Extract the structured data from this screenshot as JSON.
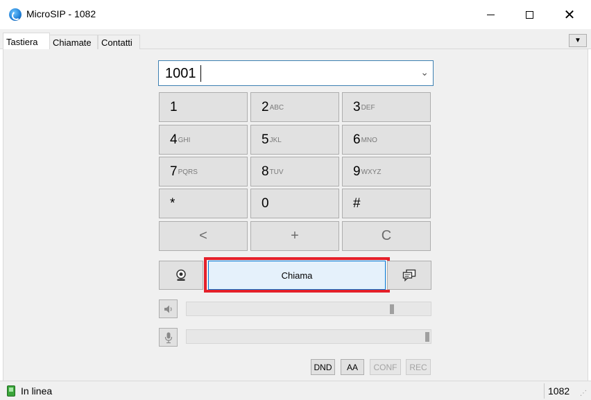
{
  "window": {
    "title": "MicroSIP - 1082"
  },
  "tabs": [
    {
      "label": "Tastiera",
      "active": true
    },
    {
      "label": "Chiamate",
      "active": false
    },
    {
      "label": "Contatti",
      "active": false
    }
  ],
  "dialer": {
    "number": "1001",
    "keys": [
      {
        "digit": "1",
        "letters": ""
      },
      {
        "digit": "2",
        "letters": "ABC"
      },
      {
        "digit": "3",
        "letters": "DEF"
      },
      {
        "digit": "4",
        "letters": "GHI"
      },
      {
        "digit": "5",
        "letters": "JKL"
      },
      {
        "digit": "6",
        "letters": "MNO"
      },
      {
        "digit": "7",
        "letters": "PQRS"
      },
      {
        "digit": "8",
        "letters": "TUV"
      },
      {
        "digit": "9",
        "letters": "WXYZ"
      },
      {
        "digit": "*",
        "letters": ""
      },
      {
        "digit": "0",
        "letters": ""
      },
      {
        "digit": "#",
        "letters": ""
      }
    ],
    "backspace_label": "<",
    "plus_label": "+",
    "clear_label": "C",
    "call_label": "Chiama",
    "speaker_level": 0.85,
    "mic_level": 1.0
  },
  "toolbar": {
    "dnd_label": "DND",
    "aa_label": "AA",
    "conf_label": "CONF",
    "rec_label": "REC"
  },
  "status": {
    "text": "In linea",
    "extension": "1082"
  },
  "colors": {
    "highlight": "#e4202a",
    "call_button_bg": "#e5f1fb",
    "online": "#3aa53a"
  }
}
